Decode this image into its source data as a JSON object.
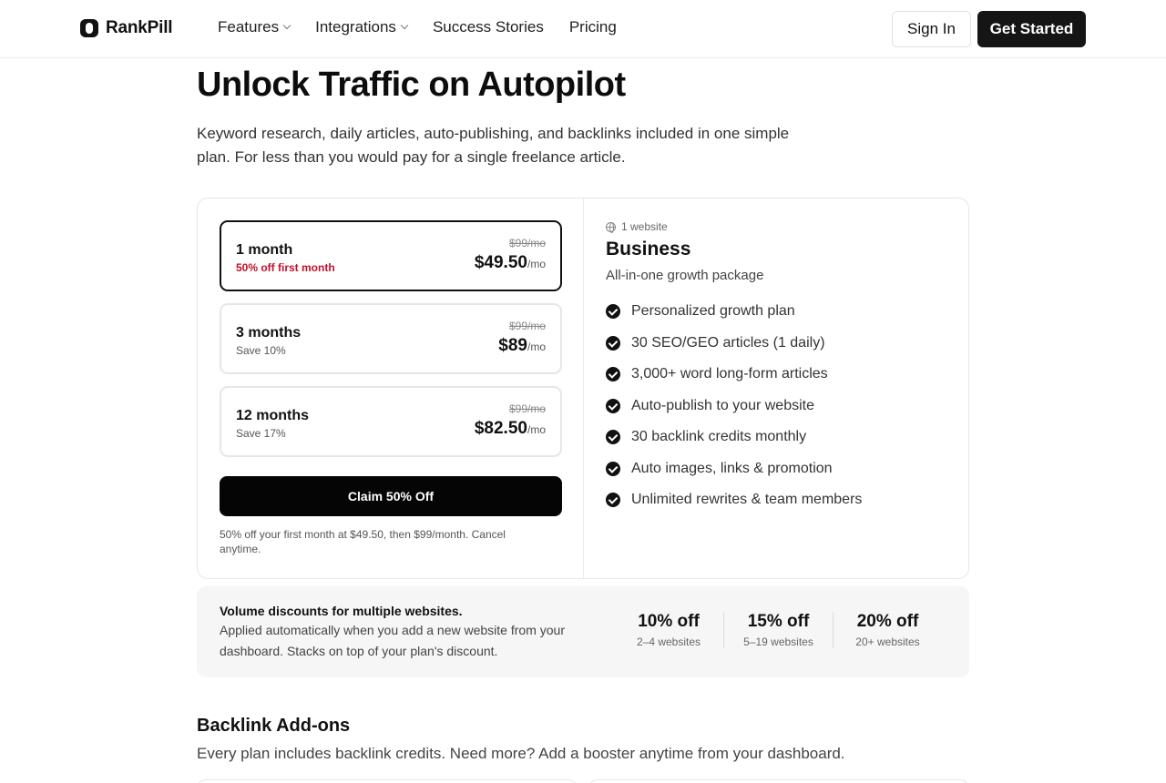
{
  "header": {
    "logo_text": "RankPill",
    "nav": [
      {
        "label": "Features",
        "has_dropdown": true
      },
      {
        "label": "Integrations",
        "has_dropdown": true
      },
      {
        "label": "Success Stories",
        "has_dropdown": false
      },
      {
        "label": "Pricing",
        "has_dropdown": false
      }
    ],
    "sign_in": "Sign In",
    "get_started": "Get Started"
  },
  "hero": {
    "title": "Unlock Traffic on Autopilot",
    "subtitle": "Keyword research, daily articles, auto-publishing, and backlinks included in one simple plan. For less than you would pay for a single freelance article."
  },
  "plans": [
    {
      "name": "1 month",
      "note": "50% off first month",
      "old_price": "$99/mo",
      "price": "$49.50",
      "unit": "/mo",
      "selected": true
    },
    {
      "name": "3 months",
      "note": "Save 10%",
      "old_price": "$99/mo",
      "price": "$89",
      "unit": "/mo",
      "selected": false
    },
    {
      "name": "12 months",
      "note": "Save 17%",
      "old_price": "$99/mo",
      "price": "$82.50",
      "unit": "/mo",
      "selected": false
    }
  ],
  "claim": {
    "label": "Claim 50% Off",
    "note": "50% off your first month at $49.50, then $99/month. Cancel anytime."
  },
  "business": {
    "site_count": "1 website",
    "title": "Business",
    "subtitle": "All-in-one growth package",
    "features": [
      "Personalized growth plan",
      "30 SEO/GEO articles (1 daily)",
      "3,000+ word long-form articles",
      "Auto-publish to your website",
      "30 backlink credits monthly",
      "Auto images, links & promotion",
      "Unlimited rewrites & team members"
    ]
  },
  "volume": {
    "title": "Volume discounts for multiple websites.",
    "description": "Applied automatically when you add a new website from your dashboard. Stacks on top of your plan's discount.",
    "tiers": [
      {
        "pct": "10% off",
        "label": "2–4 websites"
      },
      {
        "pct": "15% off",
        "label": "5–19 websites"
      },
      {
        "pct": "20% off",
        "label": "20+ websites"
      }
    ]
  },
  "backlinks": {
    "title": "Backlink Add-ons",
    "subtitle": "Every plan includes backlink credits. Need more? Add a booster anytime from your dashboard."
  },
  "colors": {
    "accent": "#111111",
    "promo": "#c0102a",
    "panel_bg": "#f6f6f6"
  }
}
